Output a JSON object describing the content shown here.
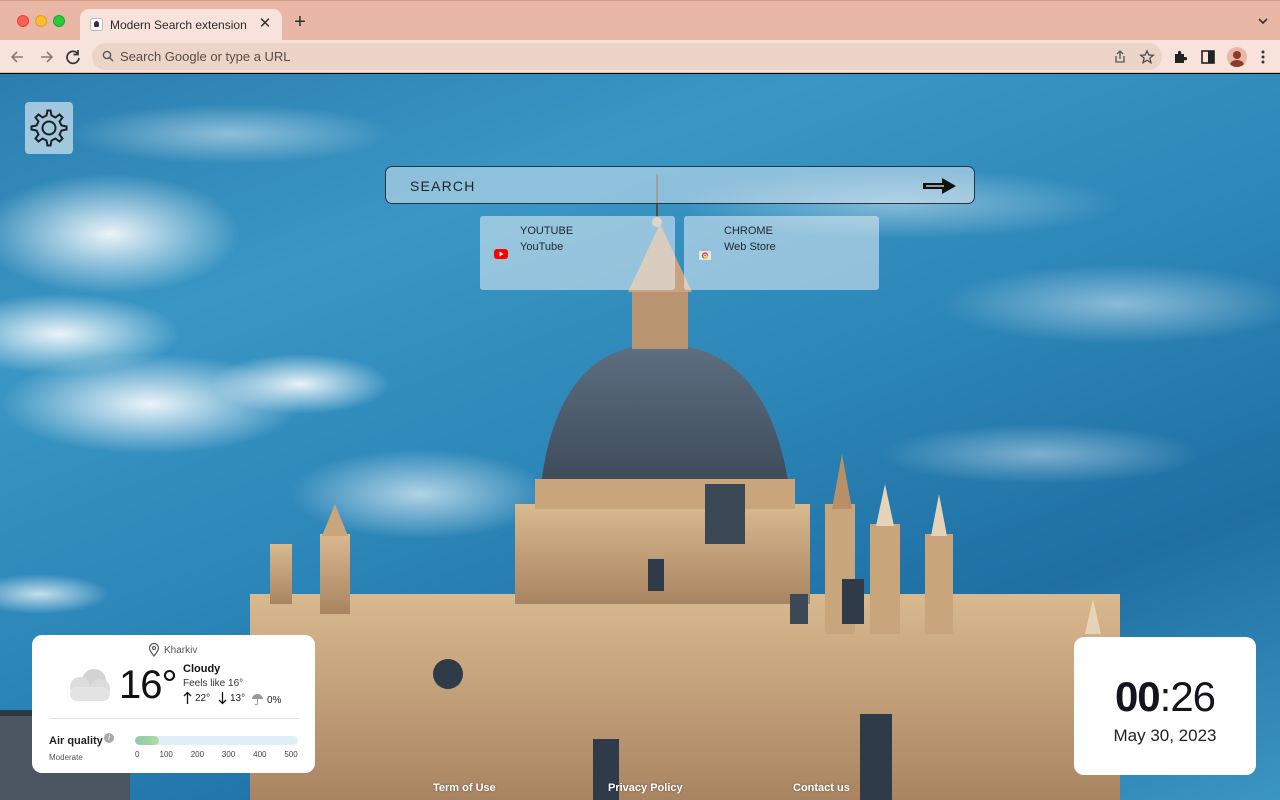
{
  "browser": {
    "tab_title": "Modern Search extension",
    "tab_close": "✕",
    "new_tab": "+",
    "address_placeholder": "Search Google or type a URL"
  },
  "search": {
    "placeholder": "SEARCH"
  },
  "shortcuts": [
    {
      "title": "YOUTUBE",
      "subtitle": "YouTube",
      "icon": "youtube-icon",
      "color": "#ff0000"
    },
    {
      "title": "CHROME",
      "subtitle": "Web Store",
      "icon": "chrome-web-store-icon",
      "color": "#e84a3a"
    }
  ],
  "weather": {
    "location": "Kharkiv",
    "temperature": "16°",
    "condition": "Cloudy",
    "feels_like": "Feels like 16°",
    "high": "22°",
    "low": "13°",
    "precipitation": "0%",
    "air_quality": {
      "label": "Air quality",
      "info": "i",
      "status": "Moderate",
      "level_fraction": 0.15,
      "scale_ticks": [
        "0",
        "100",
        "200",
        "300",
        "400",
        "500"
      ]
    }
  },
  "clock": {
    "hours": "00",
    "separator": ":",
    "minutes": "26",
    "date": "May 30, 2023"
  },
  "footer": {
    "terms": "Term of Use",
    "privacy": "Privacy Policy",
    "contact": "Contact us"
  },
  "colors": {
    "tabbar": "#e9b7a5",
    "toolbar": "#f7e3db",
    "sky": "#2b7fb0"
  }
}
